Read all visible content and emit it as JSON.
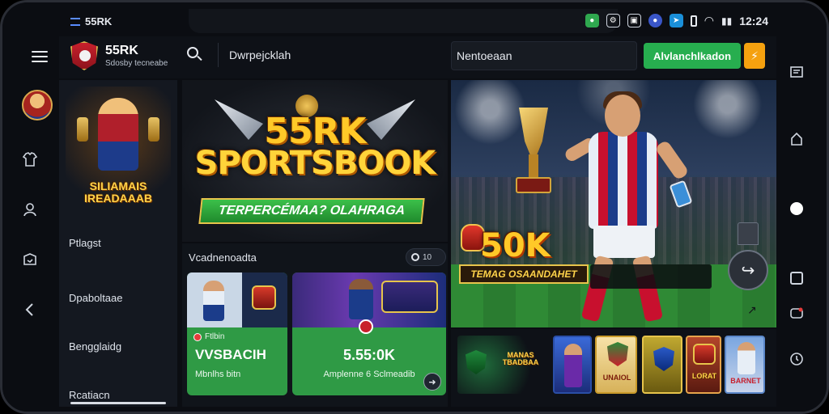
{
  "status_bar": {
    "left_label": "55RK",
    "time": "12:24"
  },
  "app_bar": {
    "brand": "55RK",
    "brand_sub": "Sdosby tecneabe",
    "search_text": "Dwrpejcklah",
    "nav_field": "Nentoeaan",
    "cta_label": "Alvlanchlkadon",
    "bolt_icon": "⚡"
  },
  "sidebar": {
    "promo_title_1": "SILIAMAIS",
    "promo_title_2": "IREADAAAB",
    "items": [
      "Ptlagst",
      "Dpaboltaae",
      "Bengglaidg",
      "Rcatiacn"
    ]
  },
  "hero": {
    "title_line1": "55RK",
    "title_line2": "SPORTSBOOK",
    "ribbon": "TERPERCÉMAA? OLAHRAGA"
  },
  "section": {
    "title": "Vcadnenoadta",
    "toggle_label": "10",
    "card1": {
      "tag": "Ftlbin",
      "big": "VVSBACIH",
      "small": "Mbnlhs bitn"
    },
    "card2": {
      "big": "5.55:0K",
      "small": "Amplenne 6 Sclmeadib"
    }
  },
  "feature": {
    "amount": "50K",
    "ribbon": "TEMAG OSAANDAHET"
  },
  "thumbs": {
    "th1_word": "MANAS TBADBAA",
    "th3_word": "UNAIOL",
    "th5_word": "LORAT",
    "th6_word": "BARNET"
  },
  "colors": {
    "accent_green": "#27ae4f",
    "accent_orange": "#f5a10f",
    "gold": "#ffc928",
    "panel_bg": "#141820"
  }
}
